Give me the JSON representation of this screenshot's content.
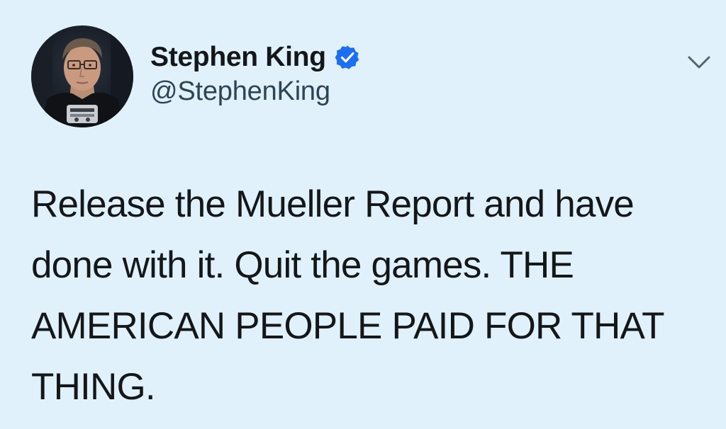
{
  "author": {
    "display_name": "Stephen King",
    "handle": "@StephenKing",
    "verified": true,
    "verified_badge_color": "#1d6ff2"
  },
  "tweet": {
    "lines": [
      "Release the Mueller Report and have",
      "done with it. Quit the games. THE",
      "AMERICAN PEOPLE PAID FOR THAT",
      "THING."
    ]
  },
  "icons": {
    "menu": "chevron-down-icon",
    "verified": "verified-badge-icon"
  },
  "colors": {
    "background": "#e1f1fb",
    "text": "#14171a",
    "handle": "#2c4457",
    "chevron": "#536471"
  }
}
